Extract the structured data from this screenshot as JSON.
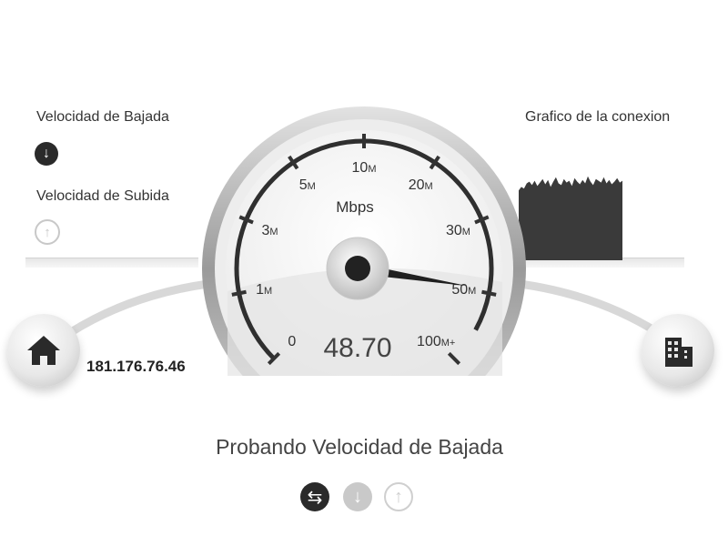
{
  "download": {
    "label": "Velocidad de Bajada",
    "icon": "download-arrow-icon"
  },
  "upload": {
    "label": "Velocidad de Subida",
    "icon": "upload-arrow-icon"
  },
  "graph": {
    "title": "Grafico de la conexion",
    "samples": [
      0.8,
      0.84,
      0.82,
      0.88,
      0.9,
      0.86,
      0.91,
      0.85,
      0.89,
      0.93,
      0.87,
      0.92,
      0.84,
      0.9,
      0.95,
      0.88,
      0.86,
      0.93,
      0.89,
      0.91,
      0.85,
      0.94,
      0.9,
      0.87,
      0.92,
      0.88,
      0.96,
      0.9,
      0.86,
      0.93,
      0.91,
      0.89,
      0.95,
      0.88,
      0.92,
      0.87,
      0.9,
      0.94,
      0.89,
      0.91
    ]
  },
  "gauge": {
    "unit": "Mbps",
    "value": "48.70",
    "value_number": 48.7,
    "ticks": [
      "0",
      "1",
      "3",
      "5",
      "10",
      "20",
      "30",
      "50",
      "100"
    ],
    "tick_suffix": [
      "",
      "M",
      "M",
      "M",
      "M",
      "M",
      "M",
      "M",
      "M+"
    ]
  },
  "client": {
    "ip": "181.176.76.46",
    "icon": "home-icon"
  },
  "server": {
    "icon": "building-icon"
  },
  "status": {
    "text": "Probando Velocidad de Bajada"
  },
  "stage_icons": [
    "ping-exchange-icon",
    "download-stage-icon",
    "upload-stage-icon"
  ]
}
